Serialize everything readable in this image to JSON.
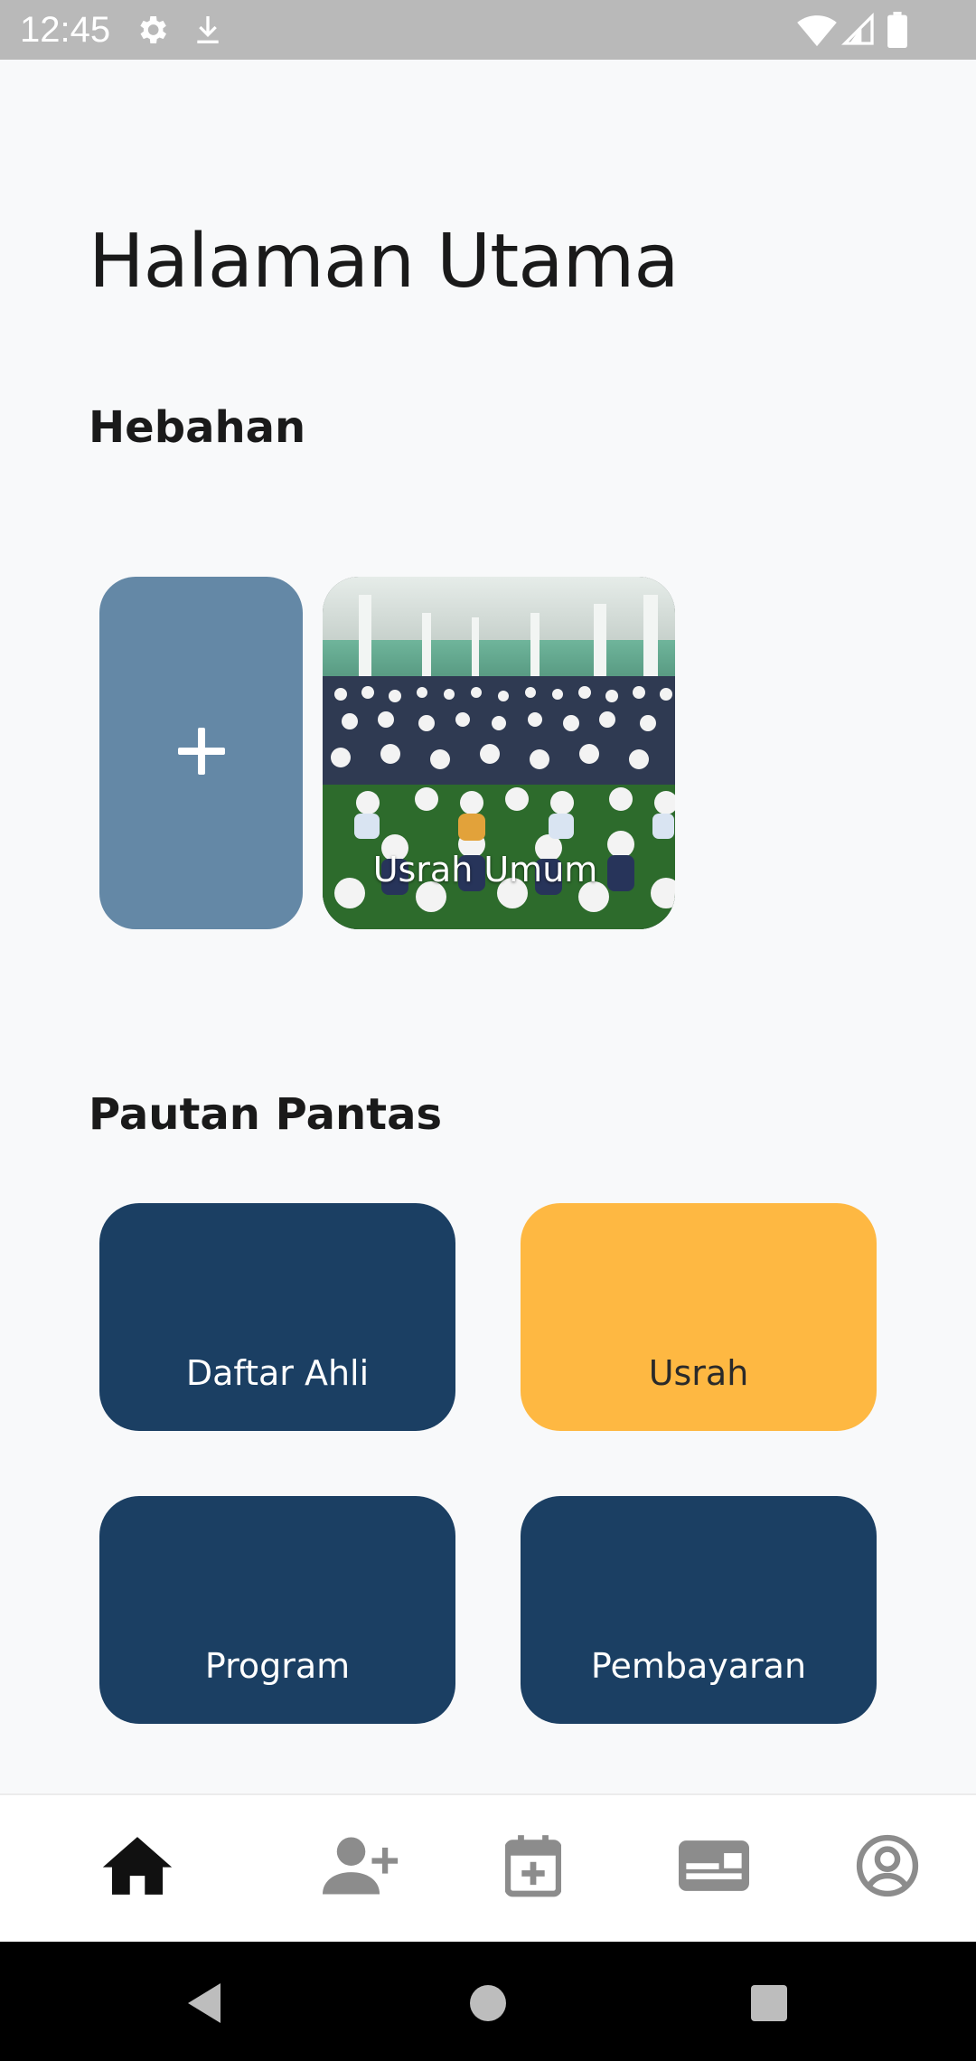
{
  "status_bar": {
    "time": "12:45",
    "icons": [
      "settings-icon",
      "download-icon",
      "wifi-icon",
      "signal-icon",
      "battery-icon"
    ]
  },
  "page": {
    "title": "Halaman Utama"
  },
  "announcements": {
    "section_title": "Hebahan",
    "add_icon": "plus-icon",
    "cards": [
      {
        "label": "Usrah Umum"
      }
    ]
  },
  "quick_links": {
    "section_title": "Pautan Pantas",
    "items": [
      {
        "label": "Daftar Ahli",
        "color": "#1b3f63"
      },
      {
        "label": "Usrah",
        "color": "#feb842"
      },
      {
        "label": "Program",
        "color": "#1b3f63"
      },
      {
        "label": "Pembayaran",
        "color": "#1b3f63"
      }
    ]
  },
  "bottom_nav": {
    "items": [
      {
        "icon": "home-icon",
        "active": true
      },
      {
        "icon": "add-person-icon",
        "active": false
      },
      {
        "icon": "calendar-add-icon",
        "active": false
      },
      {
        "icon": "card-icon",
        "active": false
      },
      {
        "icon": "account-icon",
        "active": false
      }
    ],
    "active_color": "#111111",
    "inactive_color": "#8c8c8c"
  },
  "system_nav": {
    "icons": [
      "back-icon",
      "home-circle-icon",
      "recents-icon"
    ]
  }
}
